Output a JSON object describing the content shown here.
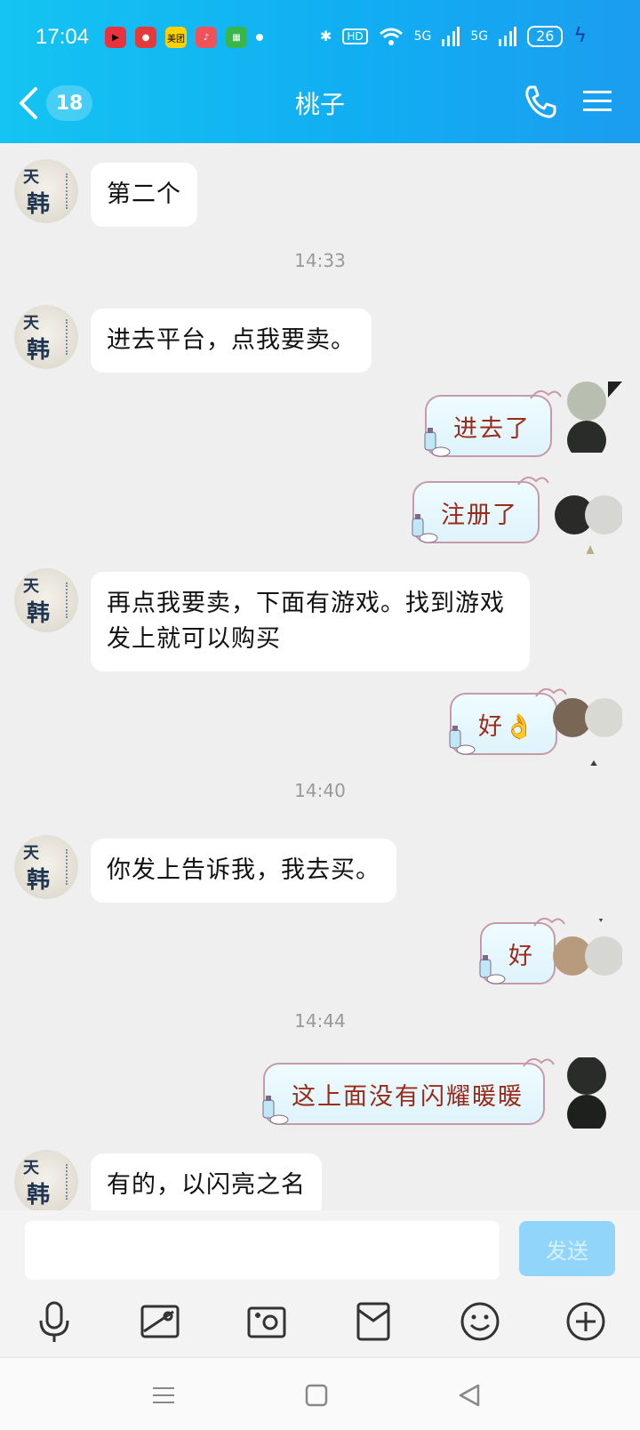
{
  "status_bar": {
    "time": "17:04",
    "app_icons": [
      {
        "name": "video-app-icon",
        "color": "#e8323f",
        "label": ""
      },
      {
        "name": "camera-app-icon",
        "color": "#e43a3a",
        "label": ""
      },
      {
        "name": "meituan-app-icon",
        "color": "#ffd100",
        "label": "美团"
      },
      {
        "name": "music-app-icon",
        "color": "#f0525a",
        "label": ""
      },
      {
        "name": "green-app-icon",
        "color": "#39b54a",
        "label": ""
      }
    ],
    "hd_label": "HD",
    "signal1": "5G",
    "signal2": "5G",
    "battery": "26"
  },
  "header": {
    "back_count": "18",
    "title": "桃子"
  },
  "messages": [
    {
      "type": "left",
      "text": "第二个"
    },
    {
      "type": "time",
      "text": "14:33"
    },
    {
      "type": "left",
      "text": "进去平台，点我要卖。"
    },
    {
      "type": "right",
      "text": "进去了"
    },
    {
      "type": "right",
      "text": "注册了"
    },
    {
      "type": "left",
      "text": "再点我要卖，下面有游戏。找到游戏发上就可以购买"
    },
    {
      "type": "right",
      "text": "好👌"
    },
    {
      "type": "time",
      "text": "14:40"
    },
    {
      "type": "left",
      "text": "你发上告诉我，我去买。"
    },
    {
      "type": "right",
      "text": "好"
    },
    {
      "type": "time",
      "text": "14:44"
    },
    {
      "type": "right",
      "text": "这上面没有闪耀暖暖"
    },
    {
      "type": "left",
      "text": "有的，以闪亮之名"
    }
  ],
  "avatar_text": {
    "top": "天",
    "main": "韩"
  },
  "input": {
    "value": "",
    "send_label": "发送"
  },
  "colors": {
    "header_start": "#14c4f2",
    "header_end": "#1b9df0",
    "send_disabled": "#92d5fb",
    "right_text": "#9a2a1a"
  }
}
